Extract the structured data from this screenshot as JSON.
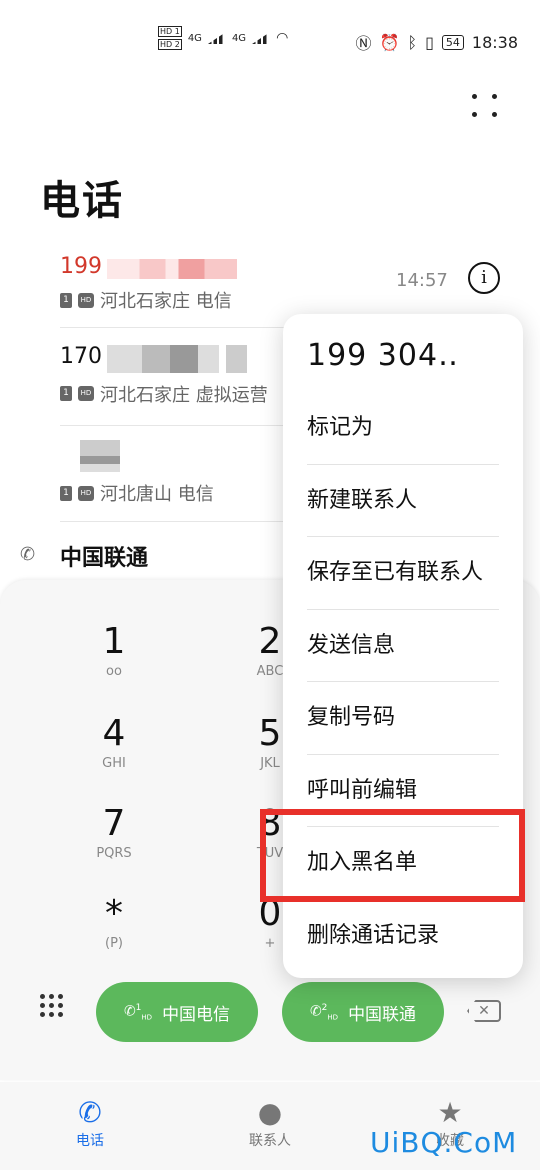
{
  "status_bar": {
    "sim1": "HD 1",
    "sim2": "HD 2",
    "net1": "4G",
    "net2": "4G",
    "battery": "54",
    "time": "18:38",
    "icons": [
      "nfc-icon",
      "alarm-icon",
      "bluetooth-icon",
      "vibrate-icon",
      "battery-icon"
    ]
  },
  "header": {
    "title": "电话"
  },
  "call_log": [
    {
      "number": "199",
      "location": "河北石家庄 电信",
      "time": "14:57",
      "missed": true,
      "sim": "1",
      "hd": "HD"
    },
    {
      "number": "170",
      "location": "河北石家庄 虚拟运营",
      "sim": "1",
      "hd": "HD"
    },
    {
      "number": "",
      "location": "河北唐山 电信",
      "sim": "1",
      "hd": "HD"
    },
    {
      "number": "中国联通",
      "location": ""
    }
  ],
  "popup": {
    "title": "199 304‥",
    "items": [
      "标记为",
      "新建联系人",
      "保存至已有联系人",
      "发送信息",
      "复制号码",
      "呼叫前编辑",
      "加入黑名单",
      "删除通话记录"
    ]
  },
  "dialpad": {
    "keys": [
      {
        "digit": "1",
        "letters": "oo"
      },
      {
        "digit": "2",
        "letters": "ABC"
      },
      {
        "digit": "4",
        "letters": "GHI"
      },
      {
        "digit": "5",
        "letters": "JKL"
      },
      {
        "digit": "7",
        "letters": "PQRS"
      },
      {
        "digit": "8",
        "letters": "TUV"
      },
      {
        "digit": "*",
        "letters": "(P)"
      },
      {
        "digit": "0",
        "letters": "+"
      }
    ],
    "call_sim1": "中国电信",
    "call_sim2": "中国联通",
    "sim1_num": "1",
    "sim2_num": "2",
    "hd": "HD"
  },
  "bottom_nav": {
    "phone": "电话",
    "contacts": "联系人",
    "favorites": "收藏"
  },
  "watermark": "UiBQ.CoM",
  "colors": {
    "missed": "#d2382b",
    "call_green": "#5cb85c",
    "active_blue": "#1a6ee8",
    "highlight_red": "#e8302a"
  }
}
